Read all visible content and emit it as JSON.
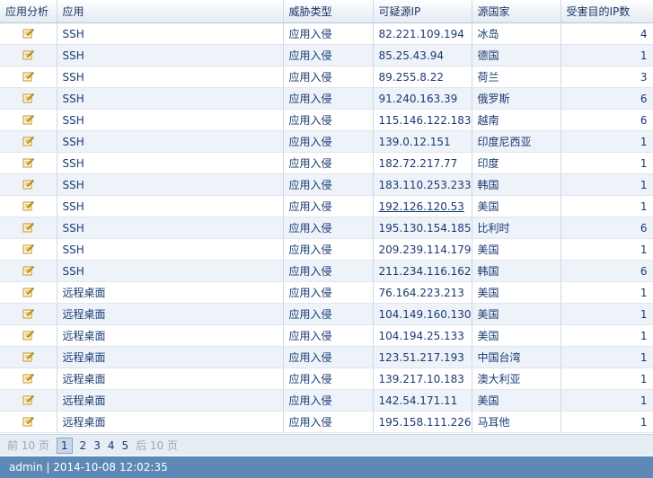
{
  "columns": [
    "应用分析",
    "应用",
    "威胁类型",
    "可疑源IP",
    "源国家",
    "受害目的IP数"
  ],
  "rows": [
    {
      "app": "SSH",
      "threat": "应用入侵",
      "ip": "82.221.109.194",
      "country": "冰岛",
      "count": "4",
      "link": false
    },
    {
      "app": "SSH",
      "threat": "应用入侵",
      "ip": "85.25.43.94",
      "country": "德国",
      "count": "1",
      "link": false
    },
    {
      "app": "SSH",
      "threat": "应用入侵",
      "ip": "89.255.8.22",
      "country": "荷兰",
      "count": "3",
      "link": false
    },
    {
      "app": "SSH",
      "threat": "应用入侵",
      "ip": "91.240.163.39",
      "country": "俄罗斯",
      "count": "6",
      "link": false
    },
    {
      "app": "SSH",
      "threat": "应用入侵",
      "ip": "115.146.122.183",
      "country": "越南",
      "count": "6",
      "link": false
    },
    {
      "app": "SSH",
      "threat": "应用入侵",
      "ip": "139.0.12.151",
      "country": "印度尼西亚",
      "count": "1",
      "link": false
    },
    {
      "app": "SSH",
      "threat": "应用入侵",
      "ip": "182.72.217.77",
      "country": "印度",
      "count": "1",
      "link": false
    },
    {
      "app": "SSH",
      "threat": "应用入侵",
      "ip": "183.110.253.233",
      "country": "韩国",
      "count": "1",
      "link": false
    },
    {
      "app": "SSH",
      "threat": "应用入侵",
      "ip": "192.126.120.53",
      "country": "美国",
      "count": "1",
      "link": true
    },
    {
      "app": "SSH",
      "threat": "应用入侵",
      "ip": "195.130.154.185",
      "country": "比利时",
      "count": "6",
      "link": false
    },
    {
      "app": "SSH",
      "threat": "应用入侵",
      "ip": "209.239.114.179",
      "country": "美国",
      "count": "1",
      "link": false
    },
    {
      "app": "SSH",
      "threat": "应用入侵",
      "ip": "211.234.116.162",
      "country": "韩国",
      "count": "6",
      "link": false
    },
    {
      "app": "远程桌面",
      "threat": "应用入侵",
      "ip": "76.164.223.213",
      "country": "美国",
      "count": "1",
      "link": false
    },
    {
      "app": "远程桌面",
      "threat": "应用入侵",
      "ip": "104.149.160.130",
      "country": "美国",
      "count": "1",
      "link": false
    },
    {
      "app": "远程桌面",
      "threat": "应用入侵",
      "ip": "104.194.25.133",
      "country": "美国",
      "count": "1",
      "link": false
    },
    {
      "app": "远程桌面",
      "threat": "应用入侵",
      "ip": "123.51.217.193",
      "country": "中国台湾",
      "count": "1",
      "link": false
    },
    {
      "app": "远程桌面",
      "threat": "应用入侵",
      "ip": "139.217.10.183",
      "country": "澳大利亚",
      "count": "1",
      "link": false
    },
    {
      "app": "远程桌面",
      "threat": "应用入侵",
      "ip": "142.54.171.11",
      "country": "美国",
      "count": "1",
      "link": false
    },
    {
      "app": "远程桌面",
      "threat": "应用入侵",
      "ip": "195.158.111.226",
      "country": "马耳他",
      "count": "1",
      "link": false
    }
  ],
  "pager": {
    "prev_label": "前 10 页",
    "pages": [
      "1",
      "2",
      "3",
      "4",
      "5"
    ],
    "current": "1",
    "next_label": "后 10 页"
  },
  "status": {
    "text": "admin | 2014-10-08 12:02:35"
  },
  "colors": {
    "status_bar": "#5c89b6",
    "row_alt": "#eef3f9",
    "text": "#1a3a73"
  },
  "icons": {
    "row_action": "edit-analysis-icon"
  }
}
